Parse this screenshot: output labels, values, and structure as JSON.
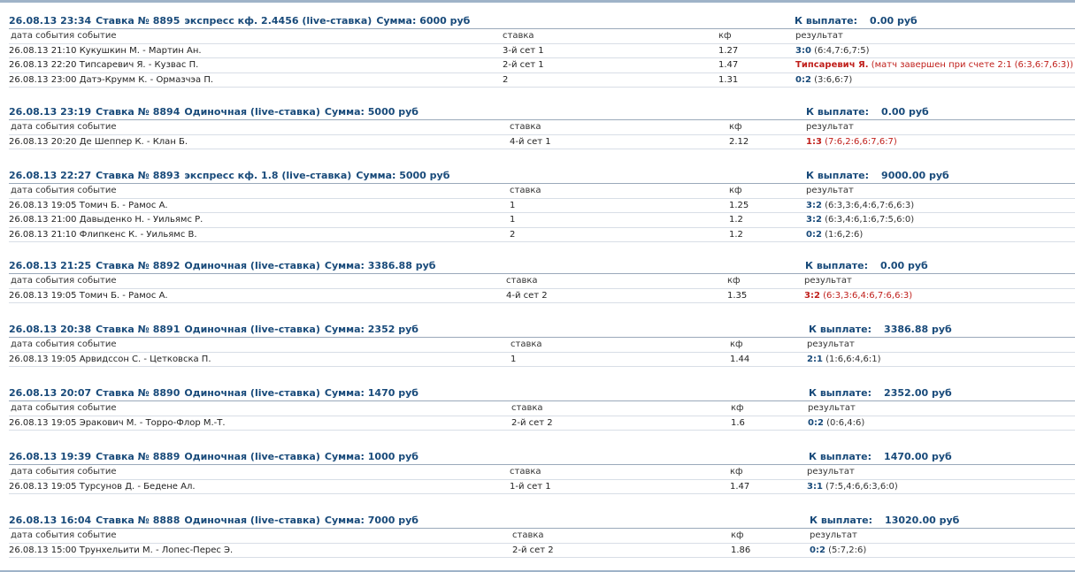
{
  "column_headers": {
    "event": "дата события событие",
    "stake": "ставка",
    "coef": "кф",
    "result": "результат"
  },
  "colors": {
    "header_text": "#184a7a",
    "lost_result": "#c0201c",
    "divider": "#9aa9ba"
  },
  "bets": [
    {
      "datetime": "26.08.13 23:34",
      "number": "Ставка № 8895",
      "type": "экспресс кф. 2.4456 (live-ставка)",
      "sum": "Сумма: 6000 руб",
      "payout_label": "К выплате:",
      "payout_value": "0.00 руб",
      "rows": [
        {
          "event": "26.08.13 21:10 Кукушкин М. - Мартин Ан.",
          "stake": "3-й сет 1",
          "coef": "1.27",
          "score": "3:0",
          "detail": "(6:4,7:6,7:5)",
          "lost": false
        },
        {
          "event": "26.08.13 22:20 Типсаревич Я. - Кузвас П.",
          "stake": "2-й сет 1",
          "coef": "1.47",
          "score": "",
          "name": "Типсаревич Я.",
          "note": "(матч завершен при счете 2:1 (6:3,6:7,6:3))",
          "lost": true
        },
        {
          "event": "26.08.13 23:00 Датэ-Крумм К. - Ормазчэа П.",
          "stake": "2",
          "coef": "1.31",
          "score": "0:2",
          "detail": "(3:6,6:7)",
          "lost": false
        }
      ]
    },
    {
      "datetime": "26.08.13 23:19",
      "number": "Ставка № 8894",
      "type": "Одиночная (live-ставка)",
      "sum": "Сумма: 5000 руб",
      "payout_label": "К выплате:",
      "payout_value": "0.00 руб",
      "rows": [
        {
          "event": "26.08.13 20:20 Де Шеппер К. - Клан Б.",
          "stake": "4-й сет 1",
          "coef": "2.12",
          "score": "1:3",
          "detail": "(7:6,2:6,6:7,6:7)",
          "lost": true
        }
      ]
    },
    {
      "datetime": "26.08.13 22:27",
      "number": "Ставка № 8893",
      "type": "экспресс кф. 1.8 (live-ставка)",
      "sum": "Сумма: 5000 руб",
      "payout_label": "К выплате:",
      "payout_value": "9000.00 руб",
      "rows": [
        {
          "event": "26.08.13 19:05 Томич Б. - Рамос А.",
          "stake": "1",
          "coef": "1.25",
          "score": "3:2",
          "detail": "(6:3,3:6,4:6,7:6,6:3)",
          "lost": false
        },
        {
          "event": "26.08.13 21:00 Давыденко Н. - Уильямс Р.",
          "stake": "1",
          "coef": "1.2",
          "score": "3:2",
          "detail": "(6:3,4:6,1:6,7:5,6:0)",
          "lost": false
        },
        {
          "event": "26.08.13 21:10 Флипкенс К. - Уильямс В.",
          "stake": "2",
          "coef": "1.2",
          "score": "0:2",
          "detail": "(1:6,2:6)",
          "lost": false
        }
      ]
    },
    {
      "datetime": "26.08.13 21:25",
      "number": "Ставка № 8892",
      "type": "Одиночная (live-ставка)",
      "sum": "Сумма: 3386.88 руб",
      "payout_label": "К выплате:",
      "payout_value": "0.00 руб",
      "rows": [
        {
          "event": "26.08.13 19:05 Томич Б. - Рамос А.",
          "stake": "4-й сет 2",
          "coef": "1.35",
          "score": "3:2",
          "detail": "(6:3,3:6,4:6,7:6,6:3)",
          "lost": true
        }
      ]
    },
    {
      "datetime": "26.08.13 20:38",
      "number": "Ставка № 8891",
      "type": "Одиночная (live-ставка)",
      "sum": "Сумма: 2352 руб",
      "payout_label": "К выплате:",
      "payout_value": "3386.88 руб",
      "rows": [
        {
          "event": "26.08.13 19:05 Арвидссон С. - Цетковска П.",
          "stake": "1",
          "coef": "1.44",
          "score": "2:1",
          "detail": "(1:6,6:4,6:1)",
          "lost": false
        }
      ]
    },
    {
      "datetime": "26.08.13 20:07",
      "number": "Ставка № 8890",
      "type": "Одиночная (live-ставка)",
      "sum": "Сумма: 1470 руб",
      "payout_label": "К выплате:",
      "payout_value": "2352.00 руб",
      "rows": [
        {
          "event": "26.08.13 19:05 Эракович М. - Торро-Флор М.-Т.",
          "stake": "2-й сет 2",
          "coef": "1.6",
          "score": "0:2",
          "detail": "(0:6,4:6)",
          "lost": false
        }
      ]
    },
    {
      "datetime": "26.08.13 19:39",
      "number": "Ставка № 8889",
      "type": "Одиночная (live-ставка)",
      "sum": "Сумма: 1000 руб",
      "payout_label": "К выплате:",
      "payout_value": "1470.00 руб",
      "rows": [
        {
          "event": "26.08.13 19:05 Турсунов Д. - Бедене Ал.",
          "stake": "1-й сет 1",
          "coef": "1.47",
          "score": "3:1",
          "detail": "(7:5,4:6,6:3,6:0)",
          "lost": false
        }
      ]
    },
    {
      "datetime": "26.08.13 16:04",
      "number": "Ставка № 8888",
      "type": "Одиночная (live-ставка)",
      "sum": "Сумма: 7000 руб",
      "payout_label": "К выплате:",
      "payout_value": "13020.00 руб",
      "rows": [
        {
          "event": "26.08.13 15:00 Трунхельити М. - Лопес-Перес Э.",
          "stake": "2-й сет 2",
          "coef": "1.86",
          "score": "0:2",
          "detail": "(5:7,2:6)",
          "lost": false
        }
      ]
    }
  ]
}
